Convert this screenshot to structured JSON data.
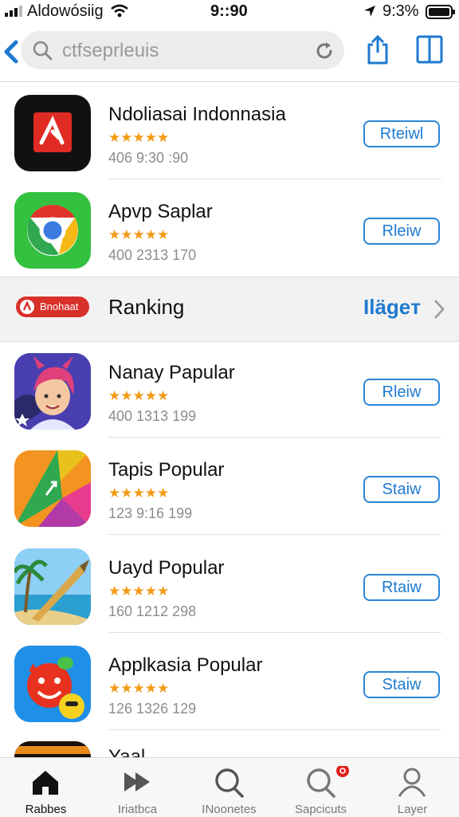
{
  "status_bar": {
    "carrier": "Aldowósiig",
    "time": "9::90",
    "battery_percent": "9:3%"
  },
  "search": {
    "placeholder": "ctfseprleuis"
  },
  "apps_top": [
    {
      "name": "Ndoliasai Indonnasia",
      "rating_stars": "★★★★★",
      "meta": "406 9:30 :90",
      "action": "Rteiwl",
      "icon": "pdf-app-icon"
    },
    {
      "name": "Apvp Saplar",
      "rating_stars": "★★★★★",
      "meta": "400 2313 170",
      "action": "Rleiw",
      "icon": "chrome-app-icon"
    }
  ],
  "ranking_section": {
    "badge_text": "Bnohaat",
    "title": "Ranking",
    "more_label": "Ilägeт"
  },
  "apps_bottom": [
    {
      "name": "Nanay Papular",
      "rating_stars": "★★★★★",
      "meta": "400 1313 199",
      "action": "Rleiw",
      "icon": "avatar-app-icon"
    },
    {
      "name": "Tapis Popular",
      "rating_stars": "★★★★★",
      "meta": "123 9:16 199",
      "action": "Staiw",
      "icon": "triangle-app-icon"
    },
    {
      "name": "Uayd Popular",
      "rating_stars": "★★★★★",
      "meta": "160 1212 298",
      "action": "Rtaiw",
      "icon": "beach-app-icon"
    },
    {
      "name": "Applkasia Popular",
      "rating_stars": "★★★★★",
      "meta": "126 1326 129",
      "action": "Staiw",
      "icon": "emoji-app-icon"
    }
  ],
  "partial_row": {
    "name": "Yaal"
  },
  "tabs": [
    {
      "label": "Rabbes",
      "icon": "home-icon",
      "active": true
    },
    {
      "label": "Iriatbca",
      "icon": "play-icon",
      "active": false
    },
    {
      "label": "INoonetes",
      "icon": "search-icon",
      "active": false
    },
    {
      "label": "Sapcicuts",
      "icon": "search-badge-icon",
      "active": false
    },
    {
      "label": "Layer",
      "icon": "person-icon",
      "active": false
    }
  ],
  "colors": {
    "accent": "#1e7ad0",
    "star": "#f39a16",
    "badge_red": "#d9302a"
  }
}
